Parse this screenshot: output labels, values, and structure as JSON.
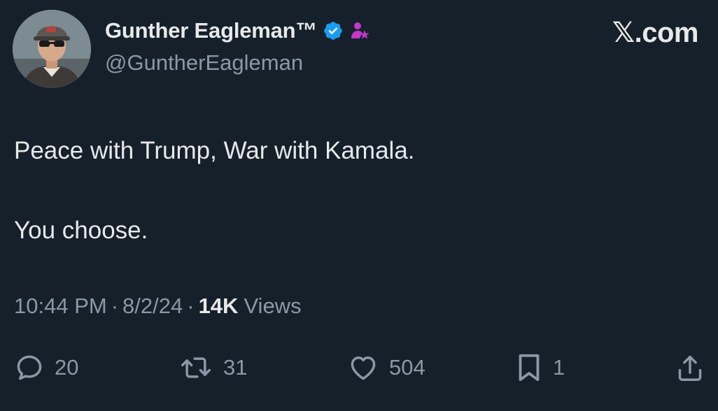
{
  "author": {
    "display_name": "Gunther Eagleman™",
    "handle": "@GuntherEagleman",
    "badges": [
      "verified-badge-icon",
      "affiliate-badge-icon"
    ],
    "badge_colors": {
      "verified": "#1d9bf0",
      "affiliate": "#c239c8"
    }
  },
  "site_logo": "𝕏.com",
  "tweet": {
    "paragraphs": [
      "Peace with Trump, War with Kamala.",
      "You choose."
    ]
  },
  "meta": {
    "time": "10:44 PM",
    "separator": "·",
    "date": "8/2/24",
    "views_count": "14K",
    "views_label": "Views"
  },
  "actions": {
    "reply": {
      "icon": "reply-icon",
      "count": "20"
    },
    "retweet": {
      "icon": "retweet-icon",
      "count": "31"
    },
    "like": {
      "icon": "heart-icon",
      "count": "504"
    },
    "bookmark": {
      "icon": "bookmark-icon",
      "count": "1"
    },
    "share": {
      "icon": "share-icon"
    }
  },
  "colors": {
    "background": "#15202b",
    "primary_text": "#e7e9ea",
    "secondary_text": "#8b98a5"
  }
}
